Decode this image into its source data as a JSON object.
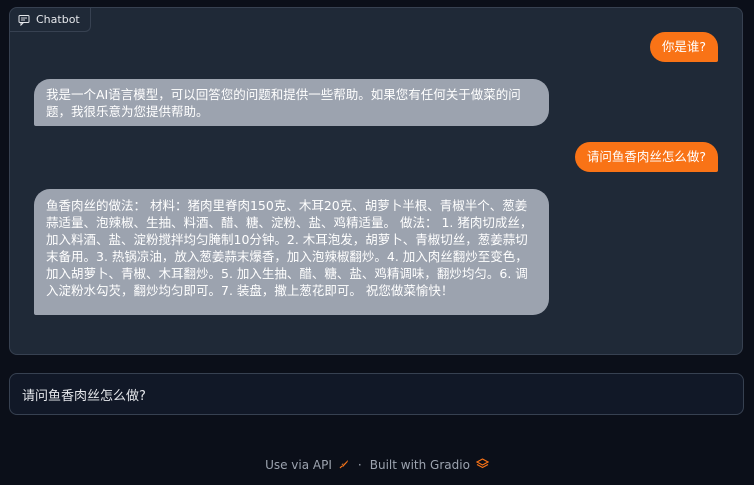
{
  "chatbot": {
    "label": "Chatbot",
    "label_icon": "chat-icon",
    "messages": [
      {
        "role": "user",
        "text": "你是谁?"
      },
      {
        "role": "bot",
        "text": "我是一个AI语言模型，可以回答您的问题和提供一些帮助。如果您有任何关于做菜的问题，我很乐意为您提供帮助。"
      },
      {
        "role": "user",
        "text": "请问鱼香肉丝怎么做?"
      },
      {
        "role": "bot",
        "text": "鱼香肉丝的做法： 材料：猪肉里脊肉150克、木耳20克、胡萝卜半根、青椒半个、葱姜蒜适量、泡辣椒、生抽、料酒、醋、糖、淀粉、盐、鸡精适量。 做法： 1. 猪肉切成丝，加入料酒、盐、淀粉搅拌均匀腌制10分钟。2. 木耳泡发，胡萝卜、青椒切丝，葱姜蒜切末备用。3. 热锅凉油，放入葱姜蒜末爆香，加入泡辣椒翻炒。4. 加入肉丝翻炒至变色，加入胡萝卜、青椒、木耳翻炒。5. 加入生抽、醋、糖、盐、鸡精调味，翻炒均匀。6. 调入淀粉水勾芡，翻炒均匀即可。7. 装盘，撒上葱花即可。 祝您做菜愉快！"
      }
    ]
  },
  "input": {
    "value": "请问鱼香肉丝怎么做?"
  },
  "footer": {
    "api_label": "Use via API",
    "separator": "·",
    "built_label": "Built with Gradio"
  },
  "colors": {
    "background": "#0b0f19",
    "user_bubble": "#f97316",
    "bot_bubble": "#9ca3af"
  }
}
